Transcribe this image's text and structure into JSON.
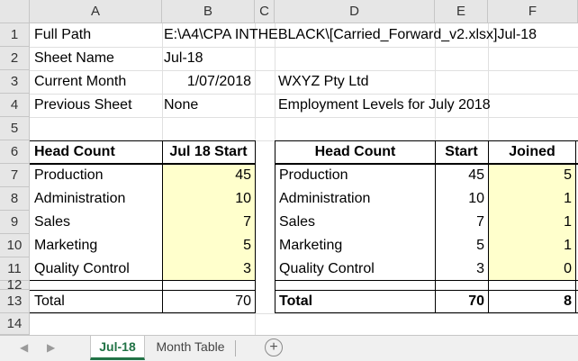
{
  "columns": [
    "A",
    "B",
    "C",
    "D",
    "E",
    "F"
  ],
  "rows": [
    "1",
    "2",
    "3",
    "4",
    "5",
    "6",
    "7",
    "8",
    "9",
    "10",
    "11",
    "12",
    "13",
    "14"
  ],
  "info": {
    "full_path_label": "Full Path",
    "full_path_value": "E:\\A4\\CPA INTHEBLACK\\[Carried_Forward_v2.xlsx]Jul-18",
    "sheet_name_label": "Sheet Name",
    "sheet_name_value": "Jul-18",
    "current_month_label": "Current Month",
    "current_month_value": "1/07/2018",
    "company": "WXYZ Pty Ltd",
    "previous_sheet_label": "Previous Sheet",
    "previous_sheet_value": "None",
    "report_title": "Employment Levels for July 2018"
  },
  "left_table": {
    "header_label": "Head Count",
    "header_start": "Jul 18 Start",
    "rows": [
      {
        "name": "Production",
        "value": "45"
      },
      {
        "name": "Administration",
        "value": "10"
      },
      {
        "name": "Sales",
        "value": "7"
      },
      {
        "name": "Marketing",
        "value": "5"
      },
      {
        "name": "Quality Control",
        "value": "3"
      }
    ],
    "total_label": "Total",
    "total_value": "70"
  },
  "right_table": {
    "header_label": "Head Count",
    "header_start": "Start",
    "header_joined": "Joined",
    "rows": [
      {
        "name": "Production",
        "start": "45",
        "joined": "5"
      },
      {
        "name": "Administration",
        "start": "10",
        "joined": "1"
      },
      {
        "name": "Sales",
        "start": "7",
        "joined": "1"
      },
      {
        "name": "Marketing",
        "start": "5",
        "joined": "1"
      },
      {
        "name": "Quality Control",
        "start": "3",
        "joined": "0"
      }
    ],
    "total_label": "Total",
    "total_start": "70",
    "total_joined": "8"
  },
  "tabs": {
    "prev_icon": "◀",
    "next_icon": "▶",
    "active": "Jul-18",
    "other": "Month Table",
    "add_icon": "+"
  },
  "colors": {
    "highlight": "#ffffcc",
    "accent": "#217346"
  }
}
